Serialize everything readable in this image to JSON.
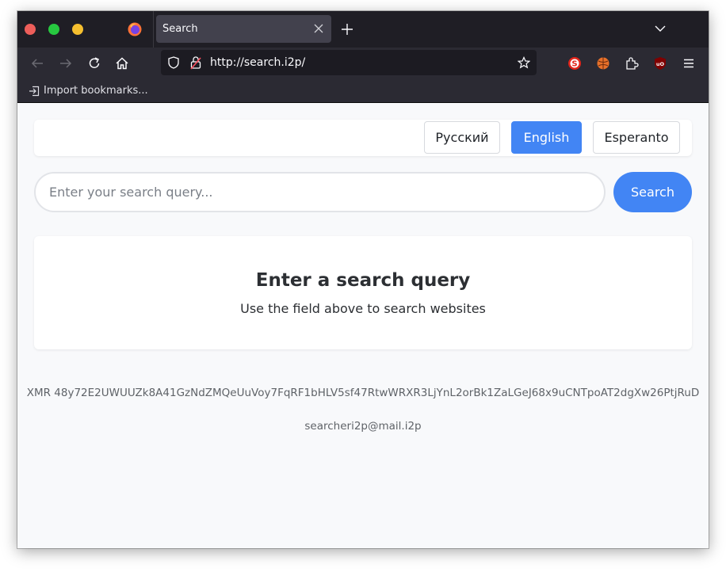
{
  "browser": {
    "tab_title": "Search",
    "url": "http://search.i2p/",
    "bookmark_import_label": "Import bookmarks..."
  },
  "languages": [
    {
      "label": "Русский",
      "active": false
    },
    {
      "label": "English",
      "active": true
    },
    {
      "label": "Esperanto",
      "active": false
    }
  ],
  "search": {
    "placeholder": "Enter your search query...",
    "button_label": "Search"
  },
  "result": {
    "title": "Enter a search query",
    "subtitle": "Use the field above to search websites"
  },
  "footer": {
    "xmr": "XMR 48y72E2UWUUZk8A41GzNdZMQeUuVoy7FqRF1bHLV5sf47RtwWRXR3LjYnL2orBk1ZaLGeJ68x9uCNTpoAT2dgXw26PtjRuD",
    "email": "searcheri2p@mail.i2p"
  },
  "colors": {
    "accent": "#4285f4",
    "tab_bar": "#1f1e25",
    "toolbar": "#2b2a33"
  }
}
